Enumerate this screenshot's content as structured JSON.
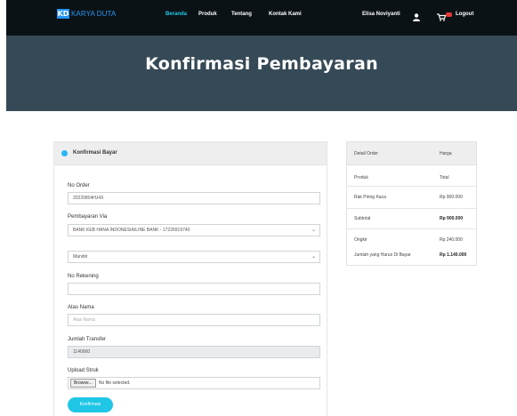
{
  "navbar": {
    "brand_mark": "KD",
    "brand_name": "KARYA DUTA",
    "links": [
      "Beranda",
      "Produk",
      "Tentang",
      "Kontak Kami"
    ],
    "user_name": "Elisa Noviyanti",
    "logout": "Logout",
    "icons": {
      "user": "user-icon",
      "cart": "cart-icon"
    },
    "colors": {
      "bg": "#0b1216",
      "active": "#1ec8e8",
      "brand": "#2196f3",
      "badge": "#e53935"
    }
  },
  "banner": {
    "title": "Konfirmasi Pembayaran",
    "bg": "#364956"
  },
  "form": {
    "header": "Konfirmasi Bayar",
    "no_order_label": "No Order",
    "no_order_value": "20220804HJ4X",
    "pembayaran_label": "Pembayaran Via",
    "pembayaran_value": "BANK KEB HANA INDONESIA/LINE BANK - 17226919740",
    "bank_value": "Mandiri",
    "rekening_label": "No Rekening",
    "rekening_value": "",
    "atas_nama_label": "Atas Nama",
    "atas_nama_placeholder": "Atas Nama",
    "jumlah_label": "Jumlah Transfer",
    "jumlah_value": "1140000",
    "upload_label": "Upload Struk",
    "browse": "Browse...",
    "no_file": "No file selected.",
    "submit": "Konfirmasi",
    "accent": "#1fc6e6"
  },
  "order": {
    "col_detail": "Detail Order",
    "col_harga": "Harga",
    "rows": [
      {
        "label": "Produk",
        "value": "Total"
      },
      {
        "label": "Rak Piring Kaca",
        "value": "Rp 900.000"
      },
      {
        "label": "Subtotal",
        "value": "Rp 900.000"
      },
      {
        "label": "Ongkir",
        "value": "Rp 240.000"
      },
      {
        "label": "Jumlah yang Harus Di Bayar",
        "value": "Rp 1.140.000"
      }
    ]
  }
}
